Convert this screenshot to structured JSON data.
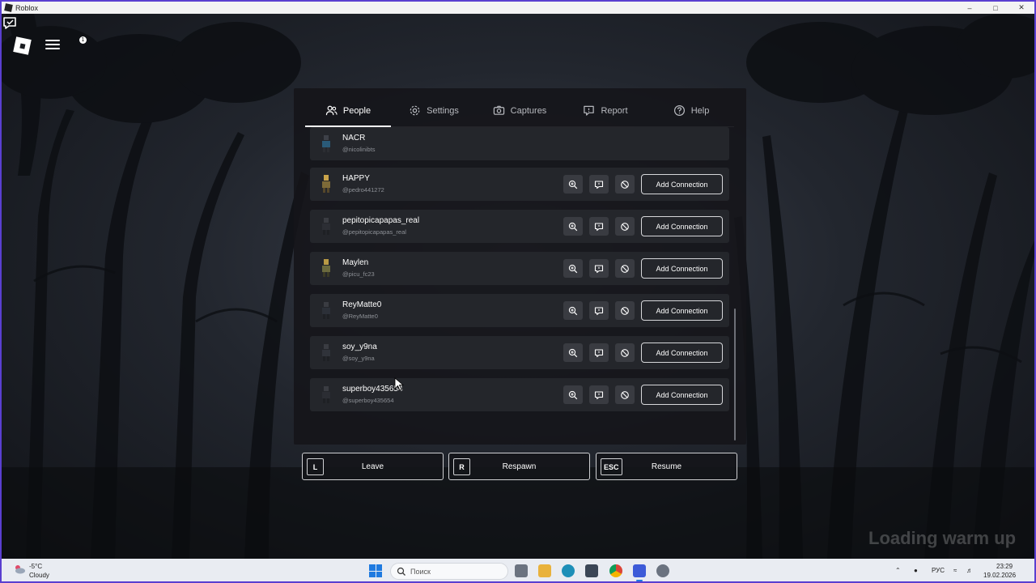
{
  "window": {
    "title": "Roblox"
  },
  "chat": {
    "badge": "1"
  },
  "tabs": [
    {
      "label": "People",
      "icon": "people-icon",
      "active": true
    },
    {
      "label": "Settings",
      "icon": "gear-icon",
      "active": false
    },
    {
      "label": "Captures",
      "icon": "camera-icon",
      "active": false
    },
    {
      "label": "Report",
      "icon": "flag-icon",
      "active": false
    },
    {
      "label": "Help",
      "icon": "help-icon",
      "active": false
    }
  ],
  "players": [
    {
      "name": "NACR",
      "handle": "@nicolinibts",
      "self": true
    },
    {
      "name": "HAPPY",
      "handle": "@pedro441272",
      "add_label": "Add Connection"
    },
    {
      "name": "pepitopicapapas_real",
      "handle": "@pepitopicapapas_real",
      "add_label": "Add Connection"
    },
    {
      "name": "Maylen",
      "handle": "@picu_fc23",
      "add_label": "Add Connection"
    },
    {
      "name": "ReyMatte0",
      "handle": "@ReyMatte0",
      "add_label": "Add Connection"
    },
    {
      "name": "soy_y9na",
      "handle": "@soy_y9na",
      "add_label": "Add Connection"
    },
    {
      "name": "superboy435654",
      "handle": "@superboy435654",
      "add_label": "Add Connection"
    }
  ],
  "actions": [
    {
      "key": "L",
      "label": "Leave"
    },
    {
      "key": "R",
      "label": "Respawn"
    },
    {
      "key": "ESC",
      "label": "Resume"
    }
  ],
  "game_overlay": {
    "text": "Loading warm up"
  },
  "taskbar": {
    "weather_temp": "-5°C",
    "weather_cond": "Cloudy",
    "search_placeholder": "Поиск",
    "lang": "РУС",
    "time": "23:29",
    "date": "19.02.2026"
  },
  "colors": {
    "accent_window_border": "#5a3fd0",
    "row_bg": "#24262b",
    "icon_btn_bg": "#393b41",
    "taskbar_accent": "#1f7ae0"
  }
}
